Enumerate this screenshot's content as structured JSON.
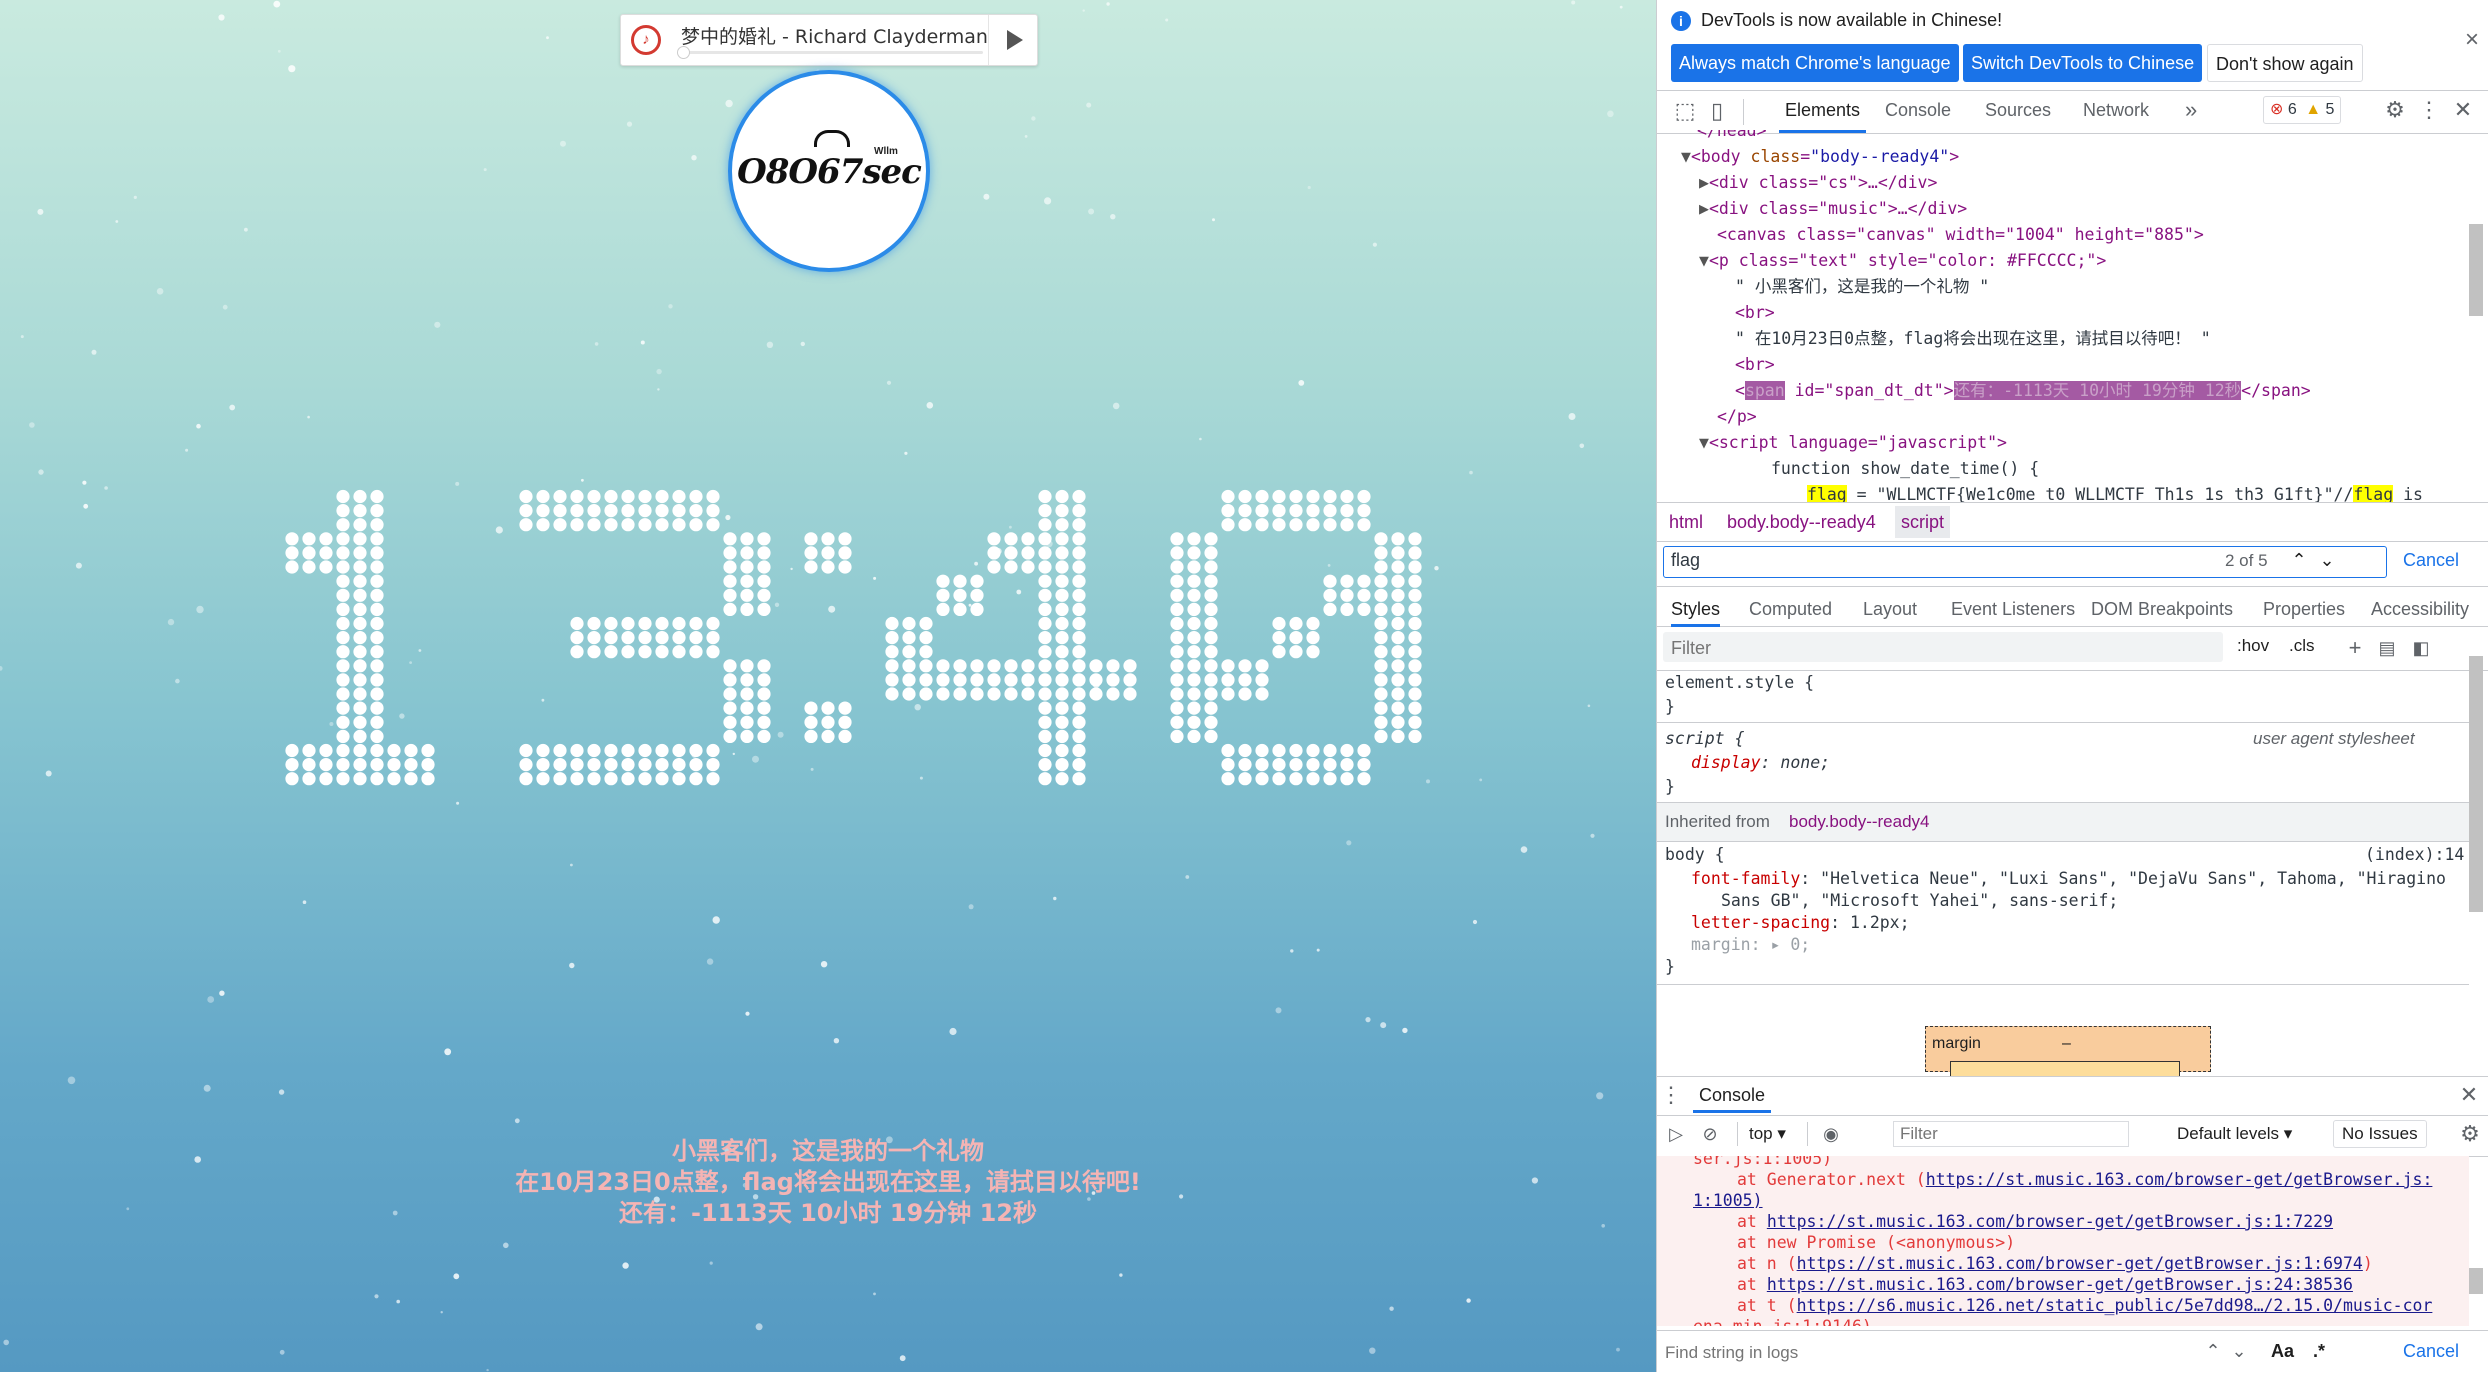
{
  "player": {
    "song": "梦中的婚礼 - Richard Clayderman",
    "logo_icon": "netease-music-icon",
    "play_icon": "play-icon"
  },
  "avatar": {
    "text": "O8O67sec",
    "sub": "Wllm"
  },
  "clock": {
    "time": "13:40"
  },
  "gift": {
    "line1": "小黑客们，这是我的一个礼物",
    "line2": "在10月23日0点整，flag将会出现在这里，请拭目以待吧!",
    "line3": "还有：-1113天 10小时 19分钟 12秒"
  },
  "devtools": {
    "banner": {
      "message": "DevTools is now available in Chinese!",
      "btn_match": "Always match Chrome's language",
      "btn_switch": "Switch DevTools to Chinese",
      "btn_dismiss": "Don't show again",
      "close": "×"
    },
    "tabs": [
      "Elements",
      "Console",
      "Sources",
      "Network",
      "»"
    ],
    "errors": "6",
    "warnings": "5",
    "tree": {
      "l0": "</head>",
      "l1_tag": "<body ",
      "l1_attr": "class",
      "l1_val": "\"body--ready4\"",
      "l1_end": ">",
      "l2": "<div class=\"cs\">…</div>",
      "l3": "<div class=\"music\">…</div>",
      "l4": "<canvas class=\"canvas\" width=\"1004\" height=\"885\">",
      "l5": "<p class=\"text\" style=\"color: #FFCCCC;\">",
      "l6": "\" 小黑客们，这是我的一个礼物 \"",
      "l7": "<br>",
      "l8": "\" 在10月23日0点整，flag将会出现在这里，请拭目以待吧！ \"",
      "l9": "<br>",
      "l10_pre": "<",
      "l10_span": "span",
      "l10_mid": " id=\"span_dt_dt\">",
      "l10_sel": "还有：-1113天 10小时 19分钟 12秒",
      "l10_end": "</span>",
      "l11": "</p>",
      "l12": "<script language=\"javascript\">",
      "l13": "function show_date_time() {",
      "l14_pre": "flag",
      "l14_mid": " = \"WLLMCTF{We1c0me_t0_WLLMCTF_Th1s_1s_th3_G1ft}\"//",
      "l14_hl": "flag",
      "l14_end": " is"
    },
    "breadcrumb": [
      "html",
      "body.body--ready4",
      "script"
    ],
    "search": {
      "value": "flag",
      "count": "2 of 5",
      "cancel": "Cancel"
    },
    "subtabs": [
      "Styles",
      "Computed",
      "Layout",
      "Event Listeners",
      "DOM Breakpoints",
      "Properties",
      "Accessibility"
    ],
    "filter_placeholder": "Filter",
    "hov": ":hov",
    "cls": ".cls",
    "styles": {
      "element_style": "element.style {",
      "brace_close": "}",
      "script_sel": "script {",
      "ua": "user agent stylesheet",
      "display_prop": "display",
      "display_val": ": none;",
      "inherited": "Inherited from ",
      "inherited_from": "body.body--ready4",
      "body_sel": "body {",
      "source": "(index):14",
      "ff_prop": "font-family",
      "ff_val1": ": \"Helvetica Neue\", \"Luxi Sans\", \"DejaVu Sans\", Tahoma, \"Hiragino",
      "ff_val2": "Sans GB\", \"Microsoft Yahei\", sans-serif;",
      "ls_prop": "letter-spacing",
      "ls_val": ": 1.2px;",
      "margin_prop": "margin",
      "margin_val": ": ▸ 0;",
      "box_margin": "margin",
      "box_dash": "–"
    },
    "console": {
      "title": "Console",
      "context": "top ▾",
      "filter_placeholder": "Filter",
      "levels": "Default levels ▾",
      "issues": "No Issues",
      "lines": [
        "ser.js:1:1005)",
        "at Generator.next (",
        "1:1005)",
        "at ",
        "at new Promise (<anonymous>)",
        "at n (",
        "at ",
        "at t (",
        "ena.min.js:1:9146)"
      ],
      "links": [
        "https://st.music.163.com/browser-get/getBrowser.js:",
        "https://st.music.163.com/browser-get/getBrowser.js:1:7229",
        "https://st.music.163.com/browser-get/getBrowser.js:1:6974",
        "https://st.music.163.com/browser-get/getBrowser.js:24:38536",
        "https://s6.music.126.net/static_public/5e7dd98…/2.15.0/music-cor"
      ],
      "tails": [
        ")",
        ")"
      ],
      "find_placeholder": "Find string in logs",
      "aa": "Aa",
      "regex": ".*",
      "cancel": "Cancel"
    }
  }
}
